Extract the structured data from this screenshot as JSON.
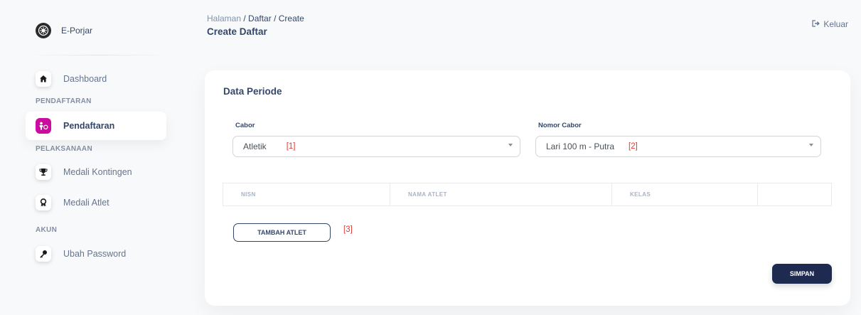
{
  "brand": {
    "name": "E-Porjar",
    "logo_icon": "emblem-icon"
  },
  "sidebar": {
    "items": [
      {
        "label": "Dashboard",
        "icon": "home-icon"
      },
      {
        "label": "Pendaftaran",
        "icon": "user-register-icon",
        "active": true
      },
      {
        "label": "Medali Kontingen",
        "icon": "trophy-icon"
      },
      {
        "label": "Medali Atlet",
        "icon": "medal-icon"
      },
      {
        "label": "Ubah Password",
        "icon": "key-icon"
      }
    ],
    "sections": [
      "PENDAFTARAN",
      "PELAKSANAAN",
      "AKUN"
    ]
  },
  "header": {
    "breadcrumb": [
      "Halaman",
      "Daftar",
      "Create"
    ],
    "title": "Create Daftar",
    "logout_label": "Keluar"
  },
  "form": {
    "title": "Data Periode",
    "cabor": {
      "label": "Cabor",
      "value": "Atletik",
      "marker": "[1]"
    },
    "nomor_cabor": {
      "label": "Nomor Cabor",
      "value": "Lari 100 m - Putra",
      "marker": "[2]"
    },
    "table": {
      "columns": [
        "NISN",
        "NAMA ATLET",
        "KELAS",
        ""
      ]
    },
    "add_button": {
      "label": "TAMBAH ATLET",
      "marker": "[3]"
    },
    "save_button": {
      "label": "SIMPAN"
    }
  },
  "colors": {
    "accent": "#cb0c9f",
    "primary_dark": "#1e2a4f",
    "text": "#344767"
  }
}
